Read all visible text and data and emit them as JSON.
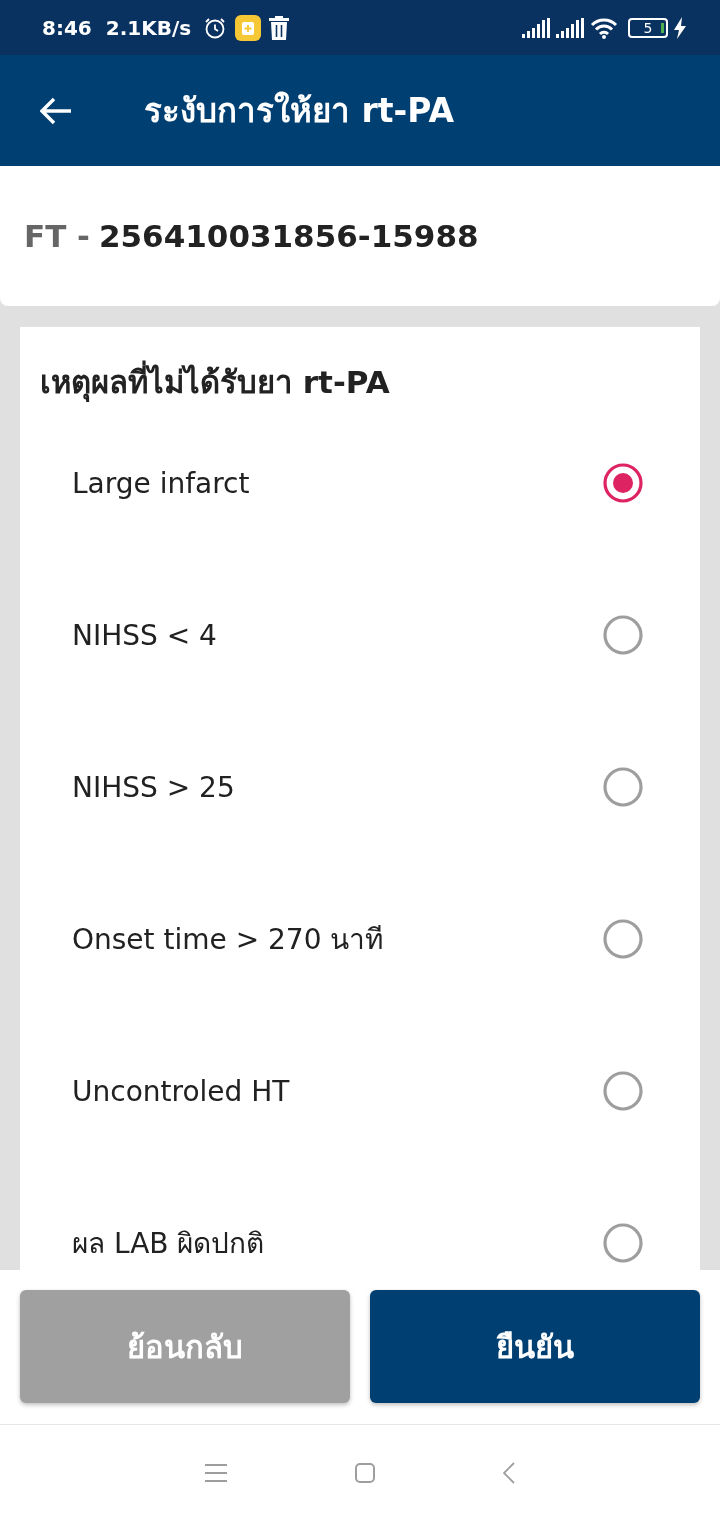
{
  "status_bar": {
    "time": "8:46",
    "network_speed": "2.1KB/s",
    "battery_text": "5"
  },
  "app_bar": {
    "title": "ระงับการให้ยา rt-PA"
  },
  "record": {
    "prefix": "FT -",
    "number": "256410031856-15988"
  },
  "reasons": {
    "title": "เหตุผลที่ไม่ได้รับยา rt-PA",
    "options": [
      {
        "label": "Large infarct",
        "selected": true
      },
      {
        "label": "NIHSS < 4",
        "selected": false
      },
      {
        "label": "NIHSS > 25",
        "selected": false
      },
      {
        "label": "Onset time > 270 นาที",
        "selected": false
      },
      {
        "label": "Uncontroled HT",
        "selected": false
      },
      {
        "label": "ผล LAB ผิดปกติ",
        "selected": false
      }
    ]
  },
  "buttons": [
    {
      "label": "ย้อนกลับ",
      "kind": "secondary"
    },
    {
      "label": "ยืนยัน",
      "kind": "primary"
    }
  ]
}
